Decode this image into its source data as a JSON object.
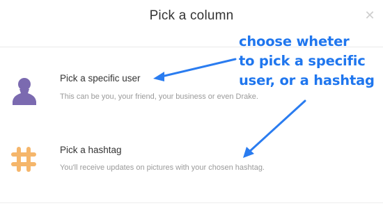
{
  "modal": {
    "title": "Pick a column",
    "close_icon": "close-icon"
  },
  "options": [
    {
      "title": "Pick a specific user",
      "description": "This can be you, your friend, your business or even Drake.",
      "icon": "user-silhouette-icon",
      "icon_color": "#7b6ab0"
    },
    {
      "title": "Pick a hashtag",
      "description": "You'll receive updates on pictures with your chosen hashtag.",
      "icon": "hashtag-icon",
      "icon_color": "#f5b66b"
    }
  ],
  "annotation": {
    "lines": [
      "choose wheter",
      "to pick a specific",
      "user, or a hashtag"
    ],
    "color": "#1f76ee"
  }
}
